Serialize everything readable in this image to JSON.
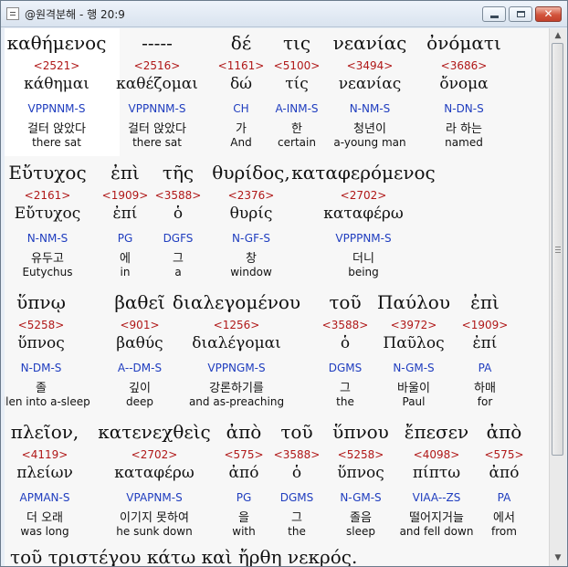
{
  "window": {
    "title": "@원격분해 - 행 20:9"
  },
  "buttons": {
    "close_glyph": "✕"
  },
  "scrollbar": {
    "up": "▲",
    "down": "▼",
    "position": 0.0
  },
  "rows": [
    [
      {
        "greek": "καθήμενος",
        "num": "<2521>",
        "lemma": "κάθημαι",
        "parse": "VPPNNM-S",
        "kor": "걸터 앉았다",
        "eng": "there sat"
      },
      {
        "greek": "-----",
        "num": "<2516>",
        "lemma": "καθέζομαι",
        "parse": "VPPNNM-S",
        "kor": "걸터 앉았다",
        "eng": "there sat"
      },
      {
        "greek": "δέ",
        "num": "<1161>",
        "lemma": "δώ",
        "parse": "CH",
        "kor": "가",
        "eng": "And"
      },
      {
        "greek": "τις",
        "num": "<5100>",
        "lemma": "τίς",
        "parse": "A-INM-S",
        "kor": "한",
        "eng": "certain"
      },
      {
        "greek": "νεανίας",
        "num": "<3494>",
        "lemma": "νεανίας",
        "parse": "N-NM-S",
        "kor": "청년이",
        "eng": "a-young man"
      },
      {
        "greek": "ὀνόματι",
        "num": "<3686>",
        "lemma": "ὄνομα",
        "parse": "N-DN-S",
        "kor": "라 하는",
        "eng": "named"
      }
    ],
    [
      {
        "greek": "Εὔτυχος",
        "num": "<2161>",
        "lemma": "Εὔτυχος",
        "parse": "N-NM-S",
        "kor": "유두고",
        "eng": "Eutychus"
      },
      {
        "greek": "ἐπὶ",
        "num": "<1909>",
        "lemma": "ἐπί",
        "parse": "PG",
        "kor": "에",
        "eng": "in"
      },
      {
        "greek": "τῆς",
        "num": "<3588>",
        "lemma": "ὁ",
        "parse": "DGFS",
        "kor": "그",
        "eng": "a"
      },
      {
        "greek": "θυρίδος,",
        "num": "<2376>",
        "lemma": "θυρίς",
        "parse": "N-GF-S",
        "kor": "창",
        "eng": "window"
      },
      {
        "greek": "καταφερόμενος",
        "num": "<2702>",
        "lemma": "καταφέρω",
        "parse": "VPPPNM-S",
        "kor": "더니",
        "eng": "being"
      }
    ],
    [
      {
        "greek": "ὕπνῳ",
        "num": "<5258>",
        "lemma": "ὕπνος",
        "parse": "N-DM-S",
        "kor": "졸",
        "eng": "fallen into a-sleep"
      },
      {
        "greek": "βαθεῖ",
        "num": "<901>",
        "lemma": "βαθύς",
        "parse": "A--DM-S",
        "kor": "깊이",
        "eng": "deep"
      },
      {
        "greek": "διαλεγομένου",
        "num": "<1256>",
        "lemma": "διαλέγομαι",
        "parse": "VPPNGM-S",
        "kor": "강론하기를",
        "eng": "and as-preaching"
      },
      {
        "greek": "τοῦ",
        "num": "<3588>",
        "lemma": "ὁ",
        "parse": "DGMS",
        "kor": "그",
        "eng": "the"
      },
      {
        "greek": "Παύλου",
        "num": "<3972>",
        "lemma": "Παῦλος",
        "parse": "N-GM-S",
        "kor": "바울이",
        "eng": "Paul"
      },
      {
        "greek": "ἐπὶ",
        "num": "<1909>",
        "lemma": "ἐπί",
        "parse": "PA",
        "kor": "하매",
        "eng": "for"
      }
    ],
    [
      {
        "greek": "πλεῖον,",
        "num": "<4119>",
        "lemma": "πλείων",
        "parse": "APMAN-S",
        "kor": "더 오래",
        "eng": "was long"
      },
      {
        "greek": "κατενεχθεὶς",
        "num": "<2702>",
        "lemma": "καταφέρω",
        "parse": "VPAPNM-S",
        "kor": "이기지 못하여",
        "eng": "he sunk down"
      },
      {
        "greek": "ἀπὸ",
        "num": "<575>",
        "lemma": "ἀπό",
        "parse": "PG",
        "kor": "을",
        "eng": "with"
      },
      {
        "greek": "τοῦ",
        "num": "<3588>",
        "lemma": "ὁ",
        "parse": "DGMS",
        "kor": "그",
        "eng": "the"
      },
      {
        "greek": "ὕπνου",
        "num": "<5258>",
        "lemma": "ὕπνος",
        "parse": "N-GM-S",
        "kor": "졸음",
        "eng": "sleep"
      },
      {
        "greek": "ἔπεσεν",
        "num": "<4098>",
        "lemma": "πίπτω",
        "parse": "VIAA--ZS",
        "kor": "떨어지거늘",
        "eng": "and fell down"
      },
      {
        "greek": "ἀπὸ",
        "num": "<575>",
        "lemma": "ἀπό",
        "parse": "PA",
        "kor": "에서",
        "eng": "from"
      }
    ]
  ],
  "partial_row": "τοῦ  τριστέγου  κάτω  καὶ  ἤρθη  νεκρός."
}
